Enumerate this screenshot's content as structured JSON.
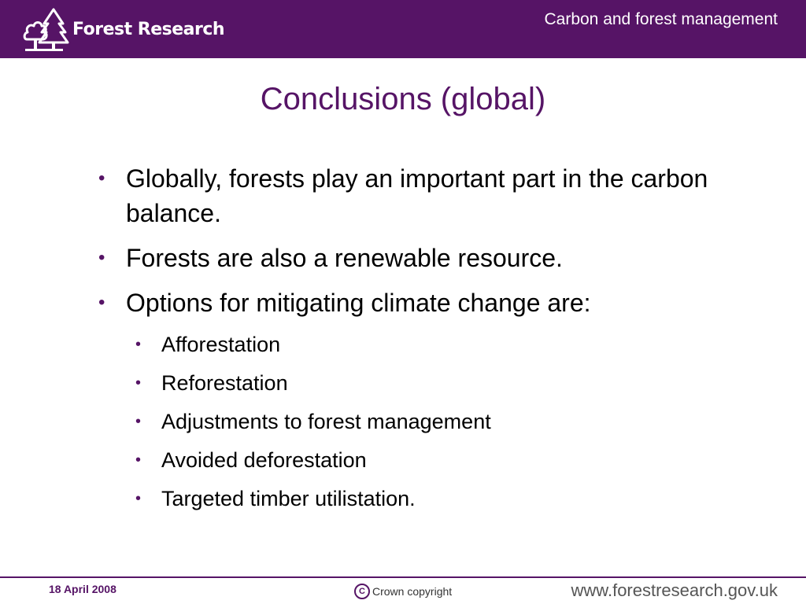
{
  "header": {
    "logo_text": "Forest Research",
    "title": "Carbon and forest management"
  },
  "slide": {
    "title": "Conclusions (global)",
    "bullets": [
      "Globally, forests play an important part in the carbon balance.",
      "Forests are also a renewable resource.",
      "Options for mitigating climate change are:"
    ],
    "sub_bullets": [
      "Afforestation",
      "Reforestation",
      "Adjustments to forest management",
      "Avoided deforestation",
      "Targeted timber utilistation."
    ]
  },
  "footer": {
    "date": "18 April 2008",
    "copyright": "Crown copyright",
    "url": "www.forestresearch.gov.uk"
  },
  "colors": {
    "brand_purple": "#561466"
  },
  "icons": [
    "tree-logo-icon",
    "copyright-icon"
  ]
}
